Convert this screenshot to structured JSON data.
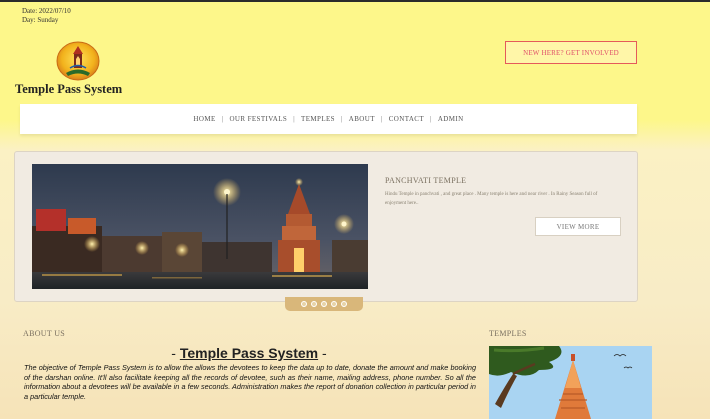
{
  "header": {
    "date_line": "Date: 2022/07/10",
    "day_line": "Day: Sunday",
    "site_title": "Temple Pass System",
    "cta_label": "NEW HERE? GET INVOLVED"
  },
  "nav": {
    "items": [
      "HOME",
      "OUR FESTIVALS",
      "TEMPLES",
      "ABOUT",
      "CONTACT",
      "ADMIN"
    ],
    "separator": "|"
  },
  "slider": {
    "title": "PANCHVATI TEMPLE",
    "description": "Hindu Temple in panchvati , and great place . Many temple is here and near river . In Rainy Season full of enjoyment here..",
    "button_label": "VIEW MORE",
    "slide_count": 5
  },
  "about": {
    "heading": "ABOUT US",
    "title_prefix": "- ",
    "title": "Temple Pass System",
    "title_suffix": " -",
    "text": "The objective of Temple Pass System is to allow the allows the devotees to keep the data up to date, donate the amount and make booking of the darshan online. It'll also facilitate keeping all the records of devotee, such as their name, mailing address, phone number. So all the information about a devotees will be available in a few seconds. Administration makes the report of donation collection in particular period in a particular temple."
  },
  "temples": {
    "heading": "TEMPLES"
  },
  "colors": {
    "header_bg": "#fdf78a",
    "cta_border": "#e55a5a",
    "cta_text": "#e0506a",
    "nav_bg": "#ffffff",
    "slider_bg": "#f1ebe2",
    "dots_bg": "#d9b77a"
  },
  "icons": {
    "logo": "temple-logo-icon"
  }
}
